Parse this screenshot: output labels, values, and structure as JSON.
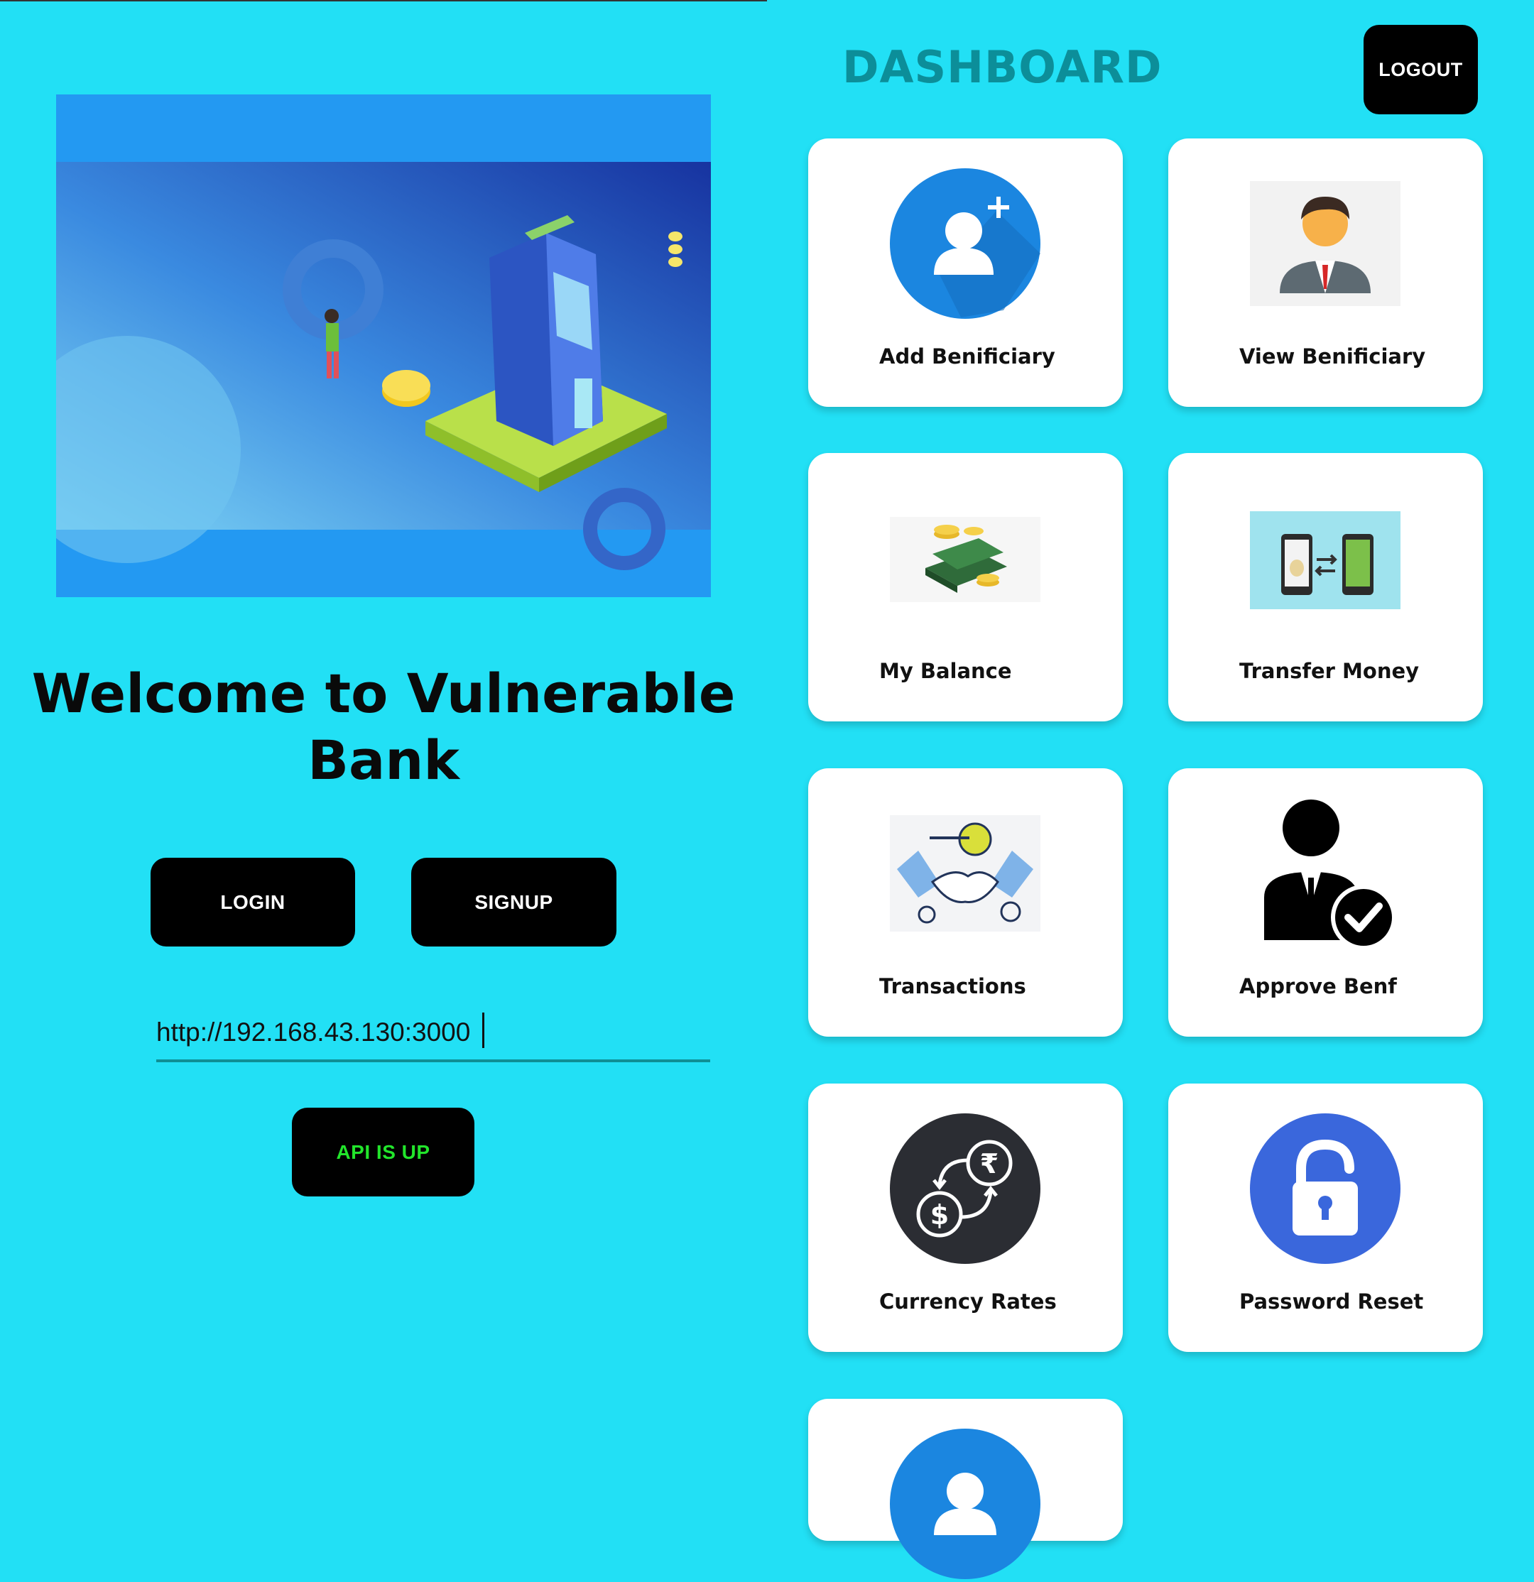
{
  "welcome": {
    "title": "Welcome to Vulnerable Bank",
    "login_label": "LOGIN",
    "signup_label": "SIGNUP",
    "url_value": "http://192.168.43.130:3000",
    "api_status_label": "API IS UP"
  },
  "dashboard": {
    "title": "DASHBOARD",
    "logout_label": "LOGOUT",
    "cards": [
      {
        "label": "Add Benificiary",
        "icon": "add-user-icon"
      },
      {
        "label": "View Benificiary",
        "icon": "person-icon"
      },
      {
        "label": "My Balance",
        "icon": "money-icon"
      },
      {
        "label": "Transfer Money",
        "icon": "transfer-icon"
      },
      {
        "label": "Transactions",
        "icon": "handshake-icon"
      },
      {
        "label": "Approve Benf",
        "icon": "approve-user-icon"
      },
      {
        "label": "Currency Rates",
        "icon": "currency-exchange-icon"
      },
      {
        "label": "Password Reset",
        "icon": "lock-icon"
      },
      {
        "label": "",
        "icon": "user-icon"
      }
    ]
  },
  "colors": {
    "background": "#22E0F5",
    "dashboard_title": "#0C8E99",
    "api_status_text": "#22E52B",
    "banner": "#2399F2"
  }
}
